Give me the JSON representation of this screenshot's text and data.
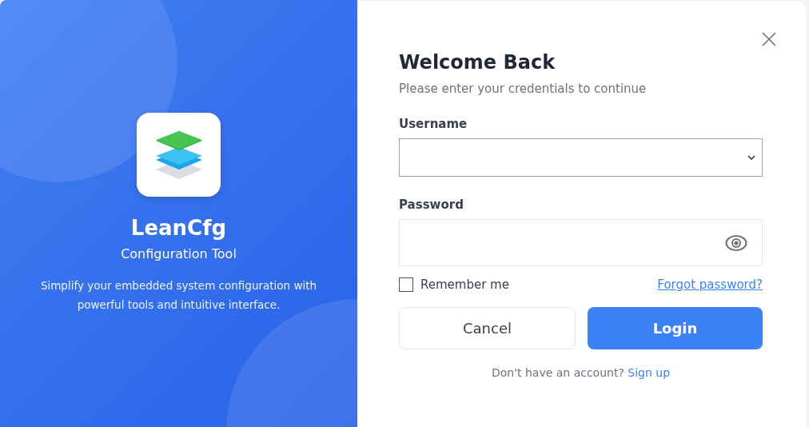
{
  "brand": {
    "name": "LeanCfg",
    "subtitle": "Configuration Tool",
    "description": "Simplify your embedded system configuration with powerful tools and intuitive interface."
  },
  "form": {
    "title": "Welcome Back",
    "subtitle": "Please enter your credentials to continue",
    "username": {
      "label": "Username"
    },
    "password": {
      "label": "Password"
    },
    "remember": {
      "label": "Remember me",
      "checked": false
    },
    "forgot": "Forgot password?",
    "buttons": [
      {
        "label": "Cancel",
        "kind": "secondary"
      },
      {
        "label": "Login",
        "kind": "primary"
      }
    ],
    "signup": {
      "text": "Don't have an account?",
      "link": "Sign up"
    }
  }
}
